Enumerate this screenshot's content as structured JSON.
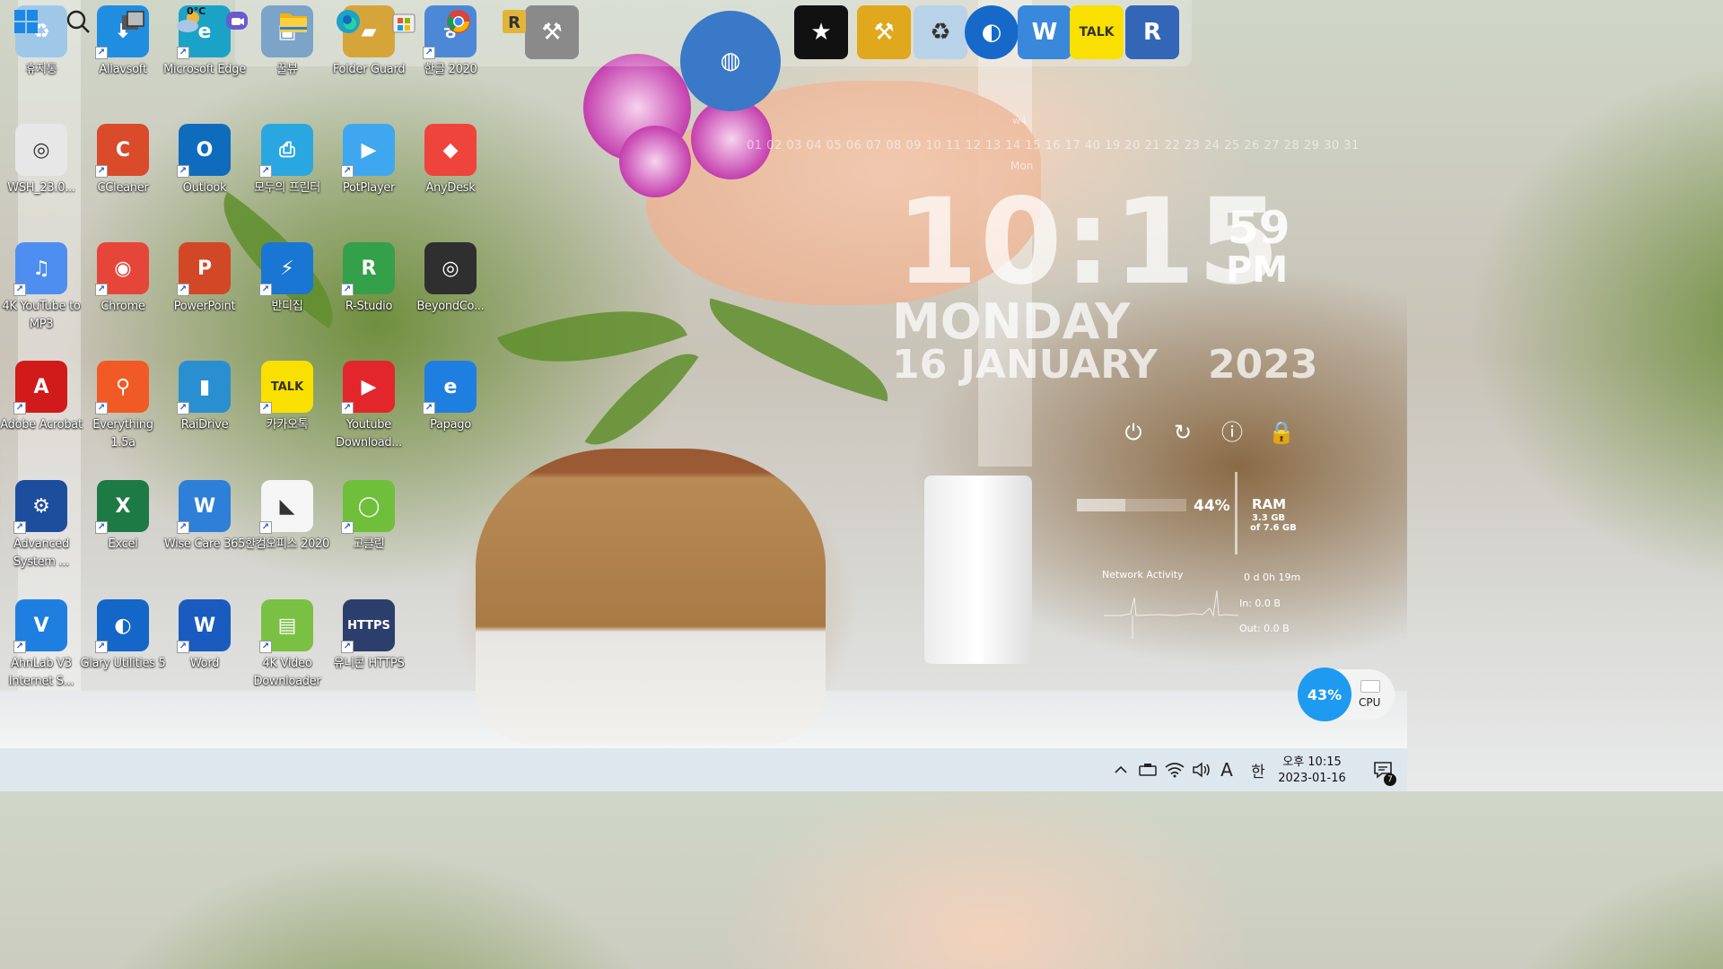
{
  "desktop_icons": [
    {
      "label": "휴지통",
      "col": 0,
      "row": 0,
      "color": "#9fc8e8",
      "glyph": "♻",
      "shortcut": false
    },
    {
      "label": "Allavsoft",
      "col": 1,
      "row": 0,
      "color": "#1f8ee0",
      "glyph": "⬇",
      "shortcut": true
    },
    {
      "label": "Microsoft Edge",
      "col": 2,
      "row": 0,
      "color": "#1aa3c7",
      "glyph": "e",
      "shortcut": true
    },
    {
      "label": "꿀뷰",
      "col": 3,
      "row": 0,
      "color": "#7ca3c8",
      "glyph": "▣",
      "shortcut": false
    },
    {
      "label": "Folder Guard",
      "col": 4,
      "row": 0,
      "color": "#d6a53a",
      "glyph": "▰",
      "shortcut": false
    },
    {
      "label": "한글 2020",
      "col": 5,
      "row": 0,
      "color": "#4c88d6",
      "glyph": "ㅎ",
      "shortcut": true
    },
    {
      "label": "WSH_23.0...",
      "col": 0,
      "row": 1,
      "color": "#e7e7e7",
      "glyph": "◎",
      "shortcut": false
    },
    {
      "label": "CCleaner",
      "col": 1,
      "row": 1,
      "color": "#d94b2b",
      "glyph": "C",
      "shortcut": true
    },
    {
      "label": "Outlook",
      "col": 2,
      "row": 1,
      "color": "#0f6cbd",
      "glyph": "O",
      "shortcut": true
    },
    {
      "label": "모두의 프린터",
      "col": 3,
      "row": 1,
      "color": "#2aa7e0",
      "glyph": "⎙",
      "shortcut": true
    },
    {
      "label": "PotPlayer",
      "col": 4,
      "row": 1,
      "color": "#3fa7f0",
      "glyph": "▶",
      "shortcut": true
    },
    {
      "label": "AnyDesk",
      "col": 5,
      "row": 1,
      "color": "#ef443b",
      "glyph": "◆",
      "shortcut": false
    },
    {
      "label": "4K YouTube to MP3",
      "col": 0,
      "row": 2,
      "color": "#4e8ef0",
      "glyph": "♫",
      "shortcut": true
    },
    {
      "label": "Chrome",
      "col": 1,
      "row": 2,
      "color": "#e6453a",
      "glyph": "◉",
      "shortcut": true
    },
    {
      "label": "PowerPoint",
      "col": 2,
      "row": 2,
      "color": "#d24726",
      "glyph": "P",
      "shortcut": true
    },
    {
      "label": "반디집",
      "col": 3,
      "row": 2,
      "color": "#1976d2",
      "glyph": "⚡",
      "shortcut": true
    },
    {
      "label": "R-Studio",
      "col": 4,
      "row": 2,
      "color": "#35a04a",
      "glyph": "R",
      "shortcut": true
    },
    {
      "label": "BeyondCo...",
      "col": 5,
      "row": 2,
      "color": "#2f2f2f",
      "glyph": "◎",
      "shortcut": false
    },
    {
      "label": "Adobe Acrobat",
      "col": 0,
      "row": 3,
      "color": "#d11a1a",
      "glyph": "A",
      "shortcut": true
    },
    {
      "label": "Everything 1.5a",
      "col": 1,
      "row": 3,
      "color": "#f15a24",
      "glyph": "⚲",
      "shortcut": true
    },
    {
      "label": "RaiDrive",
      "col": 2,
      "row": 3,
      "color": "#2a8fd0",
      "glyph": "▮",
      "shortcut": true
    },
    {
      "label": "카카오톡",
      "col": 3,
      "row": 3,
      "color": "#f9e000",
      "glyph": "TALK",
      "shortcut": true
    },
    {
      "label": "Youtube Download...",
      "col": 4,
      "row": 3,
      "color": "#e3262b",
      "glyph": "▶",
      "shortcut": true
    },
    {
      "label": "Papago",
      "col": 5,
      "row": 3,
      "color": "#1f7fe0",
      "glyph": "e",
      "shortcut": true
    },
    {
      "label": "Advanced System ...",
      "col": 0,
      "row": 4,
      "color": "#1d4e9e",
      "glyph": "⚙",
      "shortcut": true
    },
    {
      "label": "Excel",
      "col": 1,
      "row": 4,
      "color": "#1e7a44",
      "glyph": "X",
      "shortcut": true
    },
    {
      "label": "Wise Care 365",
      "col": 2,
      "row": 4,
      "color": "#2e7fd8",
      "glyph": "W",
      "shortcut": true
    },
    {
      "label": "한컴오피스 2020",
      "col": 3,
      "row": 4,
      "color": "#f5f5f5",
      "glyph": "◣",
      "shortcut": true
    },
    {
      "label": "고클린",
      "col": 4,
      "row": 4,
      "color": "#6fbf3a",
      "glyph": "◯",
      "shortcut": true
    },
    {
      "label": "AhnLab V3 Internet S...",
      "col": 0,
      "row": 5,
      "color": "#1f7fe0",
      "glyph": "V",
      "shortcut": true
    },
    {
      "label": "Glary Utilities 5",
      "col": 1,
      "row": 5,
      "color": "#1466c9",
      "glyph": "◐",
      "shortcut": true
    },
    {
      "label": "Word",
      "col": 2,
      "row": 5,
      "color": "#1a5bbf",
      "glyph": "W",
      "shortcut": true
    },
    {
      "label": "4K Video Downloader",
      "col": 3,
      "row": 5,
      "color": "#7ac043",
      "glyph": "▤",
      "shortcut": true
    },
    {
      "label": "유니콘 HTTPS",
      "col": 4,
      "row": 5,
      "color": "#2c3e6b",
      "glyph": "HTTPS",
      "shortcut": true
    }
  ],
  "dock": {
    "items": [
      {
        "name": "tools",
        "color": "#8a8a8a",
        "glyph": "⚒"
      },
      {
        "name": "globe",
        "color": "#3a78c8",
        "glyph": "◍"
      },
      {
        "name": "t-shirt",
        "color": "#111111",
        "glyph": "★"
      },
      {
        "name": "hammer",
        "color": "#e0a81c",
        "glyph": "⚒"
      },
      {
        "name": "recycle-bin",
        "color": "#b8d3e8",
        "glyph": "♻"
      },
      {
        "name": "glary-moon",
        "color": "#1769c9",
        "glyph": "◐"
      },
      {
        "name": "wise-care",
        "color": "#3a88dc",
        "glyph": "W"
      },
      {
        "name": "kakaotalk",
        "color": "#f9e000",
        "glyph": "TALK"
      },
      {
        "name": "regedit",
        "color": "#3466b8",
        "glyph": "R"
      }
    ]
  },
  "calendar": {
    "week_label": "w4",
    "days_strip": "01 02 03 04 05 06 07 08 09 10 11 12 13 14 15 16 17 40 19 20 21 22 23 24 25 26 27 28 29 30 31",
    "day_label": "Mon"
  },
  "clock": {
    "hour_minute": "10:15",
    "seconds": "59",
    "ampm": "PM",
    "weekday": "MONDAY",
    "date": "16 JANUARY",
    "year": "2023"
  },
  "power_controls": {
    "shutdown": "⏻",
    "restart": "↻",
    "logoff": "ⓘ",
    "lock": "🔒"
  },
  "system": {
    "ram_percent_label": "44%",
    "ram_fraction": 0.44,
    "ram_label": "RAM",
    "ram_used": "3.3 GB",
    "ram_total": "of 7.6 GB",
    "network_title": "Network Activity",
    "uptime": "0 d 0h 19m",
    "net_in": "In: 0.0 B",
    "net_out": "Out: 0.0 B",
    "cpu_percent": "43%",
    "cpu_label": "CPU"
  },
  "taskbar": {
    "weather_temp": "0°C",
    "clock_time": "오후 10:15",
    "clock_date": "2023-01-16",
    "notification_count": "7",
    "ime_lang": "A",
    "ime_mode": "한",
    "bg_color": "#dfe7ee"
  }
}
